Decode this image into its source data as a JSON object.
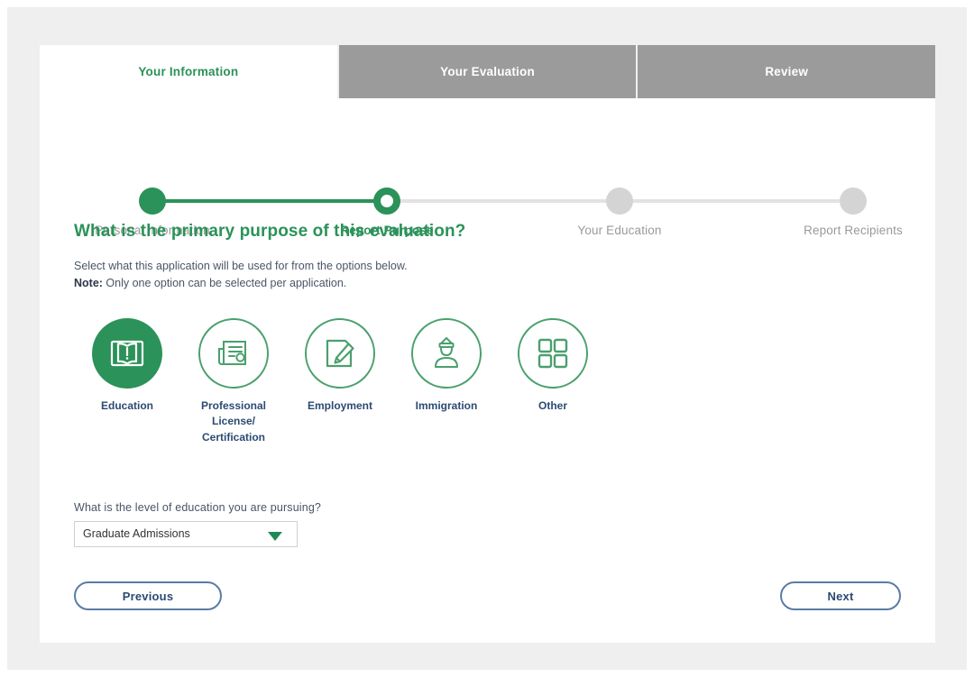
{
  "theme": {
    "green": "#2b9259",
    "green_light": "#4aa06d",
    "gray_tab": "#9b9b9b",
    "navy": "#2c4a73",
    "page_bg": "#efefef",
    "step_gray": "#d4d4d4"
  },
  "tabs": [
    {
      "label": "Your Information",
      "state": "active"
    },
    {
      "label": "Your Evaluation",
      "state": "inactive"
    },
    {
      "label": "Review",
      "state": "inactive"
    }
  ],
  "stepper": {
    "steps": [
      {
        "label": "Personal Information",
        "state": "done"
      },
      {
        "label": "Report Purpose",
        "state": "current"
      },
      {
        "label": "Your Education",
        "state": "upcoming"
      },
      {
        "label": "Report Recipients",
        "state": "upcoming"
      }
    ]
  },
  "content": {
    "heading": "What is the primary purpose of this evaluation?",
    "sub_line1": "Select what this application will be used for from the options below.",
    "note_label": "Note:",
    "note_text": " Only one option can be selected per application."
  },
  "options": [
    {
      "label": "Education",
      "icon": "open-book-icon",
      "selected": true
    },
    {
      "label": "Professional License/ Certification",
      "icon": "certificate-document-icon",
      "selected": false
    },
    {
      "label": "Employment",
      "icon": "document-pencil-icon",
      "selected": false
    },
    {
      "label": "Immigration",
      "icon": "officer-person-icon",
      "selected": false
    },
    {
      "label": "Other",
      "icon": "grid-squares-icon",
      "selected": false
    }
  ],
  "education_field": {
    "label": "What is the level of education you are pursuing?",
    "value": "Graduate Admissions"
  },
  "buttons": {
    "previous": "Previous",
    "next": "Next"
  }
}
